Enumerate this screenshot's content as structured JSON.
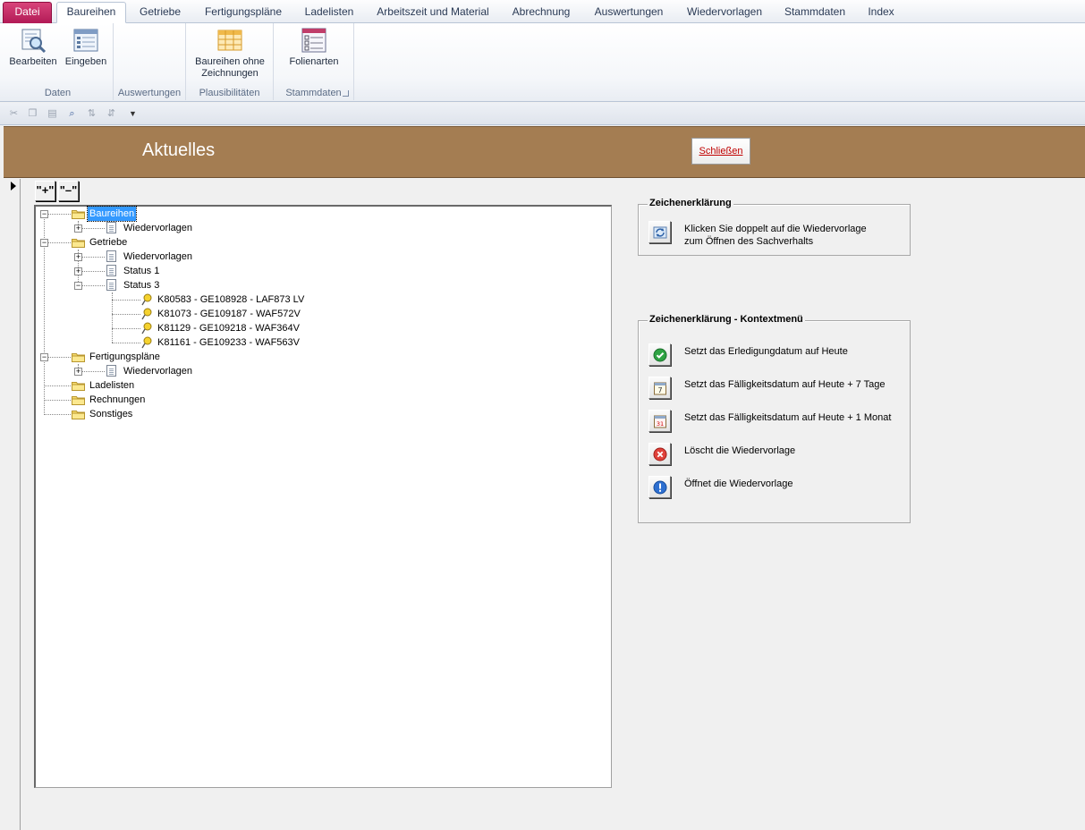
{
  "ribbon": {
    "tabs": [
      "Datei",
      "Baureihen",
      "Getriebe",
      "Fertigungspläne",
      "Ladelisten",
      "Arbeitszeit und Material",
      "Abrechnung",
      "Auswertungen",
      "Wiedervorlagen",
      "Stammdaten",
      "Index"
    ],
    "groups": {
      "daten": "Daten",
      "auswertungen": "Auswertungen",
      "plausibilitaeten": "Plausibilitäten",
      "stammdaten": "Stammdaten"
    },
    "buttons": {
      "bearbeiten": "Bearbeiten",
      "eingeben": "Eingeben",
      "baureihen_ohne_1": "Baureihen ohne",
      "baureihen_ohne_2": "Zeichnungen",
      "folienarten": "Folienarten"
    }
  },
  "form": {
    "title": "Aktuelles",
    "close_label": "Schließen",
    "expand_label": "\"+\"",
    "collapse_label": "\"–\""
  },
  "tree": {
    "baureihen": "Baureihen",
    "baureihen_wv": "Wiedervorlagen",
    "getriebe": "Getriebe",
    "getriebe_wv": "Wiedervorlagen",
    "status1": "Status 1",
    "status3": "Status 3",
    "item1": "K80583 - GE108928 - LAF873 LV",
    "item2": "K81073 - GE109187 - WAF572V",
    "item3": "K81129 - GE109218 - WAF364V",
    "item4": "K81161 - GE109233 - WAF563V",
    "fertigungsplaene": "Fertigungspläne",
    "fertigungsplaene_wv": "Wiedervorlagen",
    "ladelisten": "Ladelisten",
    "rechnungen": "Rechnungen",
    "sonstiges": "Sonstiges"
  },
  "legend": {
    "title": "Zeichenerklärung",
    "line1": "Klicken Sie doppelt auf die Wiedervorlage",
    "line2": "zum Öffnen des Sachverhalts"
  },
  "context_legend": {
    "title": "Zeichenerklärung - Kontextmenü",
    "items": [
      {
        "icon": "check-icon",
        "text": "Setzt das Erledigungdatum auf Heute"
      },
      {
        "icon": "calendar-7-icon",
        "text": "Setzt das Fälligkeitsdatum auf Heute + 7 Tage"
      },
      {
        "icon": "calendar-31-icon",
        "text": "Setzt das Fälligkeitsdatum auf Heute + 1 Monat"
      },
      {
        "icon": "delete-icon",
        "text": "Löscht die Wiedervorlage"
      },
      {
        "icon": "info-icon",
        "text": "Öffnet die Wiedervorlage"
      }
    ]
  },
  "colors": {
    "header_brown": "#a47d52",
    "file_tab": "#b21a56",
    "close_text": "#c00000",
    "selection": "#3399ff"
  }
}
